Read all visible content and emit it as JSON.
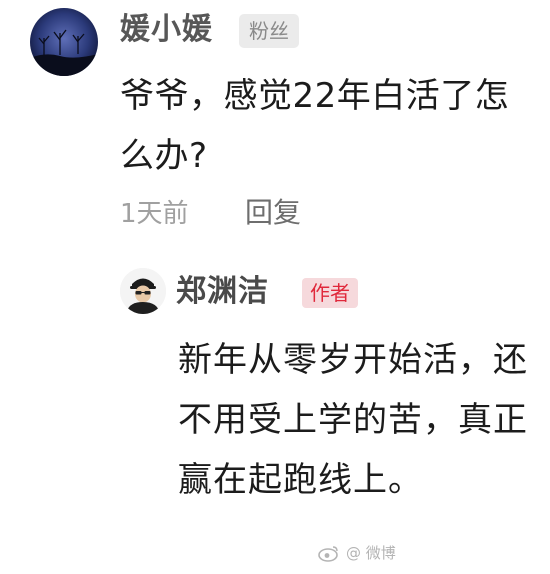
{
  "comment": {
    "username": "媛小媛",
    "badge": "粉丝",
    "text": "爷爷，感觉22年白活了怎么办?",
    "time": "1天前",
    "reply_label": "回复"
  },
  "reply": {
    "username": "郑渊洁",
    "badge": "作者",
    "text": "新年从零岁开始活，还不用受上学的苦，真正赢在起跑线上。"
  },
  "watermark": {
    "text": "@ 微博"
  },
  "colors": {
    "author_badge_bg": "#f6d9dc",
    "author_badge_text": "#e0283b",
    "fan_badge_bg": "#ebebeb"
  }
}
